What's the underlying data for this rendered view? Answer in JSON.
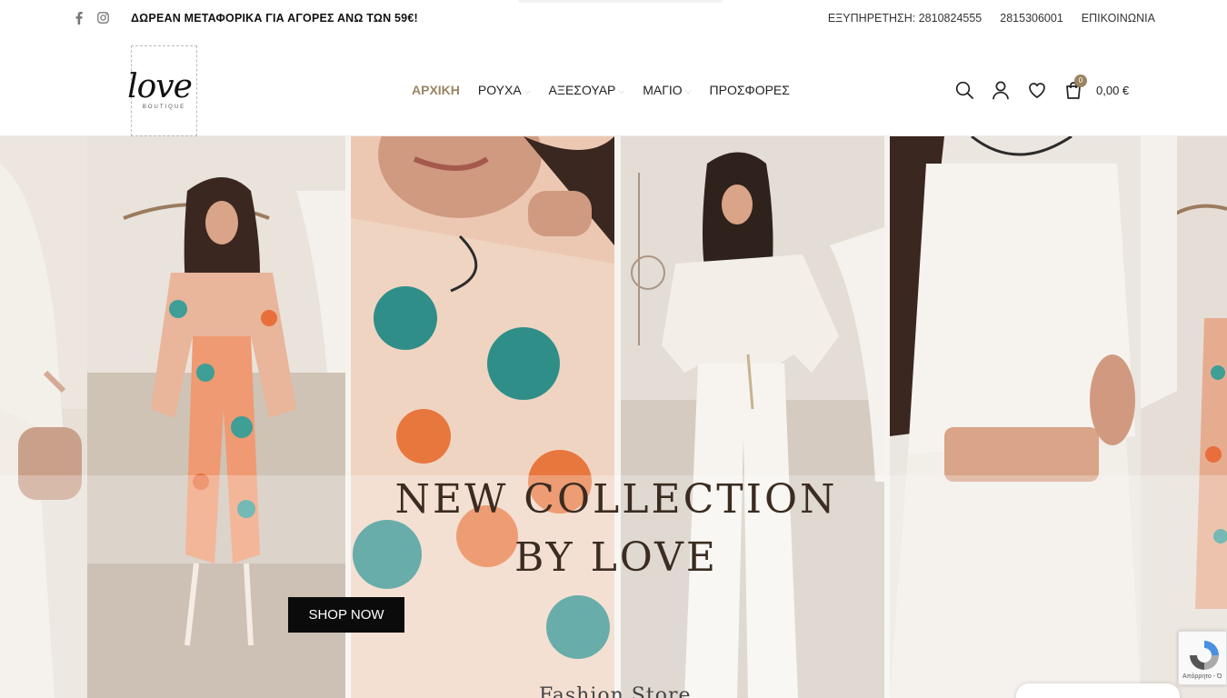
{
  "topbar": {
    "promo": "ΔΩΡΕΑΝ ΜΕΤΑΦΟΡΙΚΑ ΓΙΑ ΑΓΟΡΕΣ ΑΝΩ ΤΩΝ 59€!",
    "service": "ΕΞΥΠΗΡΕΤΗΣΗ: 2810824555",
    "phone2": "2815306001",
    "contact": "ΕΠΙΚΟΙΝΩΝΙΑ",
    "social_icons": [
      "facebook-icon",
      "instagram-icon"
    ]
  },
  "logo": {
    "script": "love",
    "sub": "BOUTIQUE"
  },
  "nav": {
    "items": [
      {
        "label": "ΑΡΧΙΚΗ",
        "active": true,
        "dropdown": false
      },
      {
        "label": "ΡΟΥΧΑ",
        "active": false,
        "dropdown": true
      },
      {
        "label": "ΑΞΕΣΟΥΑΡ",
        "active": false,
        "dropdown": true
      },
      {
        "label": "ΜΑΓΙΟ",
        "active": false,
        "dropdown": true
      },
      {
        "label": "ΠΡΟΣΦΟΡΕΣ",
        "active": false,
        "dropdown": false
      }
    ],
    "chevron": "⌵"
  },
  "header_icons": [
    "search-icon",
    "user-icon",
    "heart-icon",
    "cart-icon"
  ],
  "cart": {
    "count": "0",
    "total": "0,00 €"
  },
  "hero": {
    "headline_line1": "NEW COLLECTION",
    "headline_line2": "BY LOVE",
    "button": "SHOP NOW",
    "subtitle": "Fashion Store"
  },
  "recaptcha": {
    "label": "Απόρρητο - Ό"
  },
  "colors": {
    "accent": "#9b8462",
    "heading": "#3b2c22",
    "button_bg": "#0b0b0b"
  }
}
